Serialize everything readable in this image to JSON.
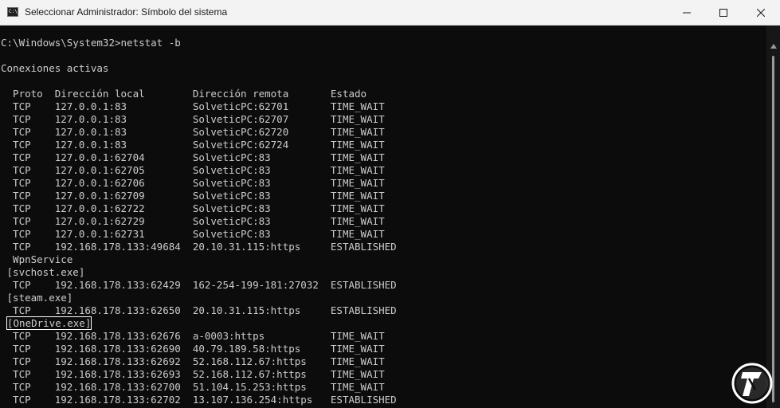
{
  "window": {
    "title": "Seleccionar Administrador: Símbolo del sistema",
    "app_icon_text": "C:\\"
  },
  "console": {
    "prompt_line": "C:\\Windows\\System32>netstat -b",
    "heading": "Conexiones activas",
    "header_line": "  Proto  Dirección local        Dirección remota       Estado",
    "lines": [
      "  TCP    127.0.0.1:83           SolveticPC:62701       TIME_WAIT",
      "  TCP    127.0.0.1:83           SolveticPC:62707       TIME_WAIT",
      "  TCP    127.0.0.1:83           SolveticPC:62720       TIME_WAIT",
      "  TCP    127.0.0.1:83           SolveticPC:62724       TIME_WAIT",
      "  TCP    127.0.0.1:62704        SolveticPC:83          TIME_WAIT",
      "  TCP    127.0.0.1:62705        SolveticPC:83          TIME_WAIT",
      "  TCP    127.0.0.1:62706        SolveticPC:83          TIME_WAIT",
      "  TCP    127.0.0.1:62709        SolveticPC:83          TIME_WAIT",
      "  TCP    127.0.0.1:62722        SolveticPC:83          TIME_WAIT",
      "  TCP    127.0.0.1:62729        SolveticPC:83          TIME_WAIT",
      "  TCP    127.0.0.1:62731        SolveticPC:83          TIME_WAIT",
      "  TCP    192.168.178.133:49684  20.10.31.115:https     ESTABLISHED",
      "  WpnService",
      " [svchost.exe]",
      "  TCP    192.168.178.133:62429  162-254-199-181:27032  ESTABLISHED",
      " [steam.exe]",
      "  TCP    192.168.178.133:62650  20.10.31.115:https     ESTABLISHED",
      " [OneDrive.exe]",
      "  TCP    192.168.178.133:62676  a-0003:https           TIME_WAIT",
      "  TCP    192.168.178.133:62690  40.79.189.58:https     TIME_WAIT",
      "  TCP    192.168.178.133:62692  52.168.112.67:https    TIME_WAIT",
      "  TCP    192.168.178.133:62693  52.168.112.67:https    TIME_WAIT",
      "  TCP    192.168.178.133:62700  51.104.15.253:https    TIME_WAIT",
      "  TCP    192.168.178.133:62702  13.107.136.254:https   ESTABLISHED"
    ],
    "selected_line_index": 17
  },
  "colors": {
    "console_background": "#0c0c0c",
    "console_text": "#cccccc",
    "titlebar": "#f3f3f3",
    "selection_outline": "#ffffff"
  },
  "icons": [
    "console-app-icon",
    "minimize-icon",
    "maximize-icon",
    "close-icon",
    "scroll-up-arrow-icon",
    "watermark-logo-icon"
  ]
}
